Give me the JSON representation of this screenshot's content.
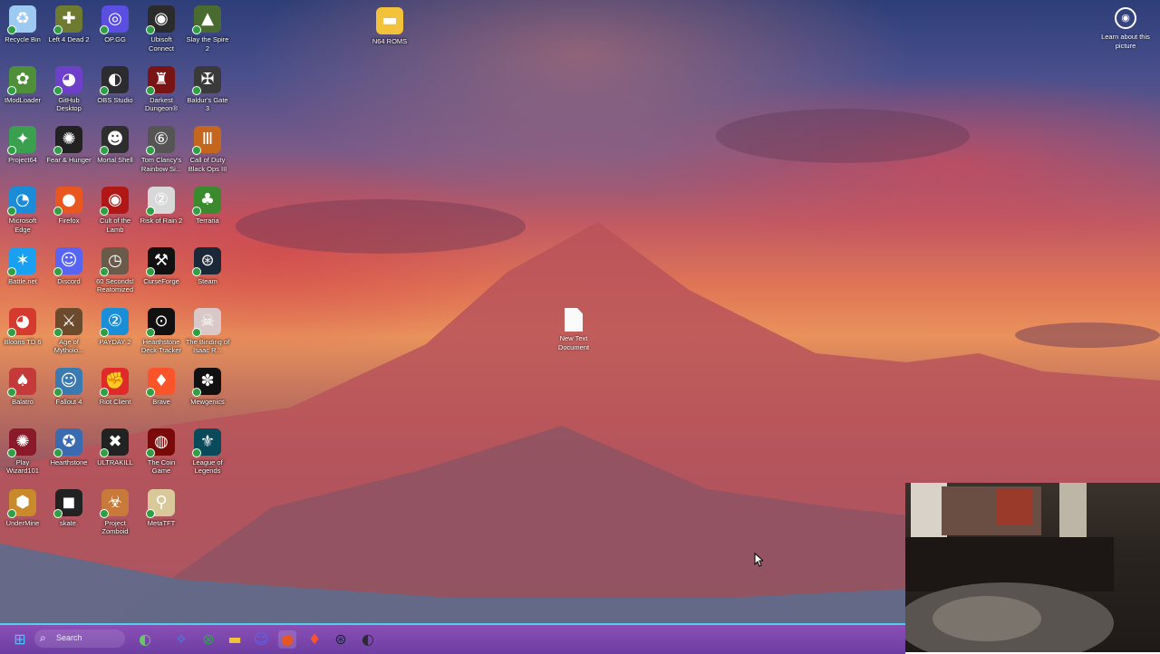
{
  "desktop": {
    "icons": [
      {
        "label": "Recycle Bin",
        "icon": "recycle-bin-icon",
        "color": "#9ec9f0"
      },
      {
        "label": "Left 4 Dead 2",
        "icon": "left4dead2-icon",
        "color": "#6d7a2f"
      },
      {
        "label": "OP.GG",
        "icon": "opgg-icon",
        "color": "#5a4fe0"
      },
      {
        "label": "Ubisoft Connect",
        "icon": "ubisoft-icon",
        "color": "#2b2b2b"
      },
      {
        "label": "Slay the Spire 2",
        "icon": "slay-the-spire-icon",
        "color": "#4a6b2f"
      },
      {
        "label": "tModLoader",
        "icon": "tmodloader-icon",
        "color": "#4f8f3a"
      },
      {
        "label": "GitHub Desktop",
        "icon": "github-icon",
        "color": "#6e40c9"
      },
      {
        "label": "OBS Studio",
        "icon": "obs-icon",
        "color": "#2b2b30"
      },
      {
        "label": "Darkest Dungeon®",
        "icon": "darkest-dungeon-icon",
        "color": "#7a1414"
      },
      {
        "label": "Baldur's Gate 3",
        "icon": "baldurs-gate-icon",
        "color": "#3a3a3a"
      },
      {
        "label": "Project64",
        "icon": "project64-icon",
        "color": "#3aa050"
      },
      {
        "label": "Fear & Hunger",
        "icon": "fear-hunger-icon",
        "color": "#222222"
      },
      {
        "label": "Mortal Shell",
        "icon": "mortal-shell-icon",
        "color": "#2e2e2e"
      },
      {
        "label": "Tom Clancy's Rainbow Si...",
        "icon": "rainbow-six-icon",
        "color": "#555555"
      },
      {
        "label": "Call of Duty Black Ops III",
        "icon": "call-of-duty-icon",
        "color": "#c4661d"
      },
      {
        "label": "Microsoft Edge",
        "icon": "edge-icon",
        "color": "#1b8cd8"
      },
      {
        "label": "Firefox",
        "icon": "firefox-icon",
        "color": "#e8571f"
      },
      {
        "label": "Cult of the Lamb",
        "icon": "cult-of-the-lamb-icon",
        "color": "#b01818"
      },
      {
        "label": "Risk of Rain 2",
        "icon": "risk-of-rain-icon",
        "color": "#d8d8d8"
      },
      {
        "label": "Terraria",
        "icon": "terraria-icon",
        "color": "#3c8a2e"
      },
      {
        "label": "Battle.net",
        "icon": "battlenet-icon",
        "color": "#1aa0f0"
      },
      {
        "label": "Discord",
        "icon": "discord-icon",
        "color": "#5865f2"
      },
      {
        "label": "60 Seconds! Reatomized",
        "icon": "sixty-seconds-icon",
        "color": "#6a5a4a"
      },
      {
        "label": "CurseForge",
        "icon": "curseforge-icon",
        "color": "#111111"
      },
      {
        "label": "Steam",
        "icon": "steam-icon",
        "color": "#1b2838"
      },
      {
        "label": "Bloons TD 6",
        "icon": "bloons-icon",
        "color": "#d43a2e"
      },
      {
        "label": "Age of Mytholo...",
        "icon": "age-of-mythology-icon",
        "color": "#6c4a2e"
      },
      {
        "label": "PAYDAY 2",
        "icon": "payday-icon",
        "color": "#1a8fd8"
      },
      {
        "label": "Hearthstone Deck Tracker",
        "icon": "deck-tracker-icon",
        "color": "#111111"
      },
      {
        "label": "The Binding of Isaac R...",
        "icon": "binding-of-isaac-icon",
        "color": "#d8c8c8"
      },
      {
        "label": "Balatro",
        "icon": "balatro-icon",
        "color": "#c43a3a"
      },
      {
        "label": "Fallout 4",
        "icon": "fallout-icon",
        "color": "#3a7ab0"
      },
      {
        "label": "Riot Client",
        "icon": "riot-client-icon",
        "color": "#e02a2a"
      },
      {
        "label": "Brave",
        "icon": "brave-icon",
        "color": "#fb542b"
      },
      {
        "label": "Mewgenics",
        "icon": "mewgenics-icon",
        "color": "#111111"
      },
      {
        "label": "Play Wizard101",
        "icon": "wizard101-icon",
        "color": "#8a1a2a"
      },
      {
        "label": "Hearthstone",
        "icon": "hearthstone-icon",
        "color": "#3a6ab0"
      },
      {
        "label": "ULTRAKILL",
        "icon": "ultrakill-icon",
        "color": "#222222"
      },
      {
        "label": "The Coin Game",
        "icon": "coin-game-icon",
        "color": "#7a0a0a"
      },
      {
        "label": "League of Legends",
        "icon": "league-icon",
        "color": "#0a4a5a"
      },
      {
        "label": "UnderMine",
        "icon": "undermine-icon",
        "color": "#c88a2a"
      },
      {
        "label": "skate.",
        "icon": "skate-icon",
        "color": "#222222"
      },
      {
        "label": "Project Zomboid",
        "icon": "project-zomboid-icon",
        "color": "#c87a3a"
      },
      {
        "label": "MetaTFT",
        "icon": "metatft-icon",
        "color": "#d8c89a"
      }
    ],
    "n64_folder": {
      "label": "N64 ROMS",
      "icon": "folder-icon",
      "color": "#f2c23a"
    },
    "new_text_doc": {
      "label": "New Text Document",
      "icon": "text-document-icon"
    },
    "learn_picture": {
      "label": "Learn about this picture",
      "icon": "camera-info-icon"
    }
  },
  "taskbar": {
    "search_placeholder": "Search",
    "items": [
      {
        "name": "start-button",
        "icon": "windows-icon",
        "color": "#4cc2ff"
      },
      {
        "name": "widgets-button",
        "icon": "widgets-icon",
        "color": "#6ac46a"
      },
      {
        "name": "copilot-button",
        "icon": "copilot-icon",
        "color": "#3a8ef0"
      },
      {
        "name": "xbox-button",
        "icon": "xbox-icon",
        "color": "#2ca84a"
      },
      {
        "name": "file-explorer-button",
        "icon": "folder-icon",
        "color": "#f2c23a"
      },
      {
        "name": "discord-taskbar-button",
        "icon": "discord-icon",
        "color": "#5865f2"
      },
      {
        "name": "firefox-taskbar-button",
        "icon": "firefox-icon",
        "color": "#e8571f"
      },
      {
        "name": "brave-taskbar-button",
        "icon": "brave-icon",
        "color": "#fb542b"
      },
      {
        "name": "steam-taskbar-button",
        "icon": "steam-icon",
        "color": "#1b2838"
      },
      {
        "name": "obs-taskbar-button",
        "icon": "obs-icon",
        "color": "#2b2b30"
      }
    ]
  },
  "colors": {
    "taskbar": "#7a46ad",
    "accent": "#4fd1e8"
  }
}
